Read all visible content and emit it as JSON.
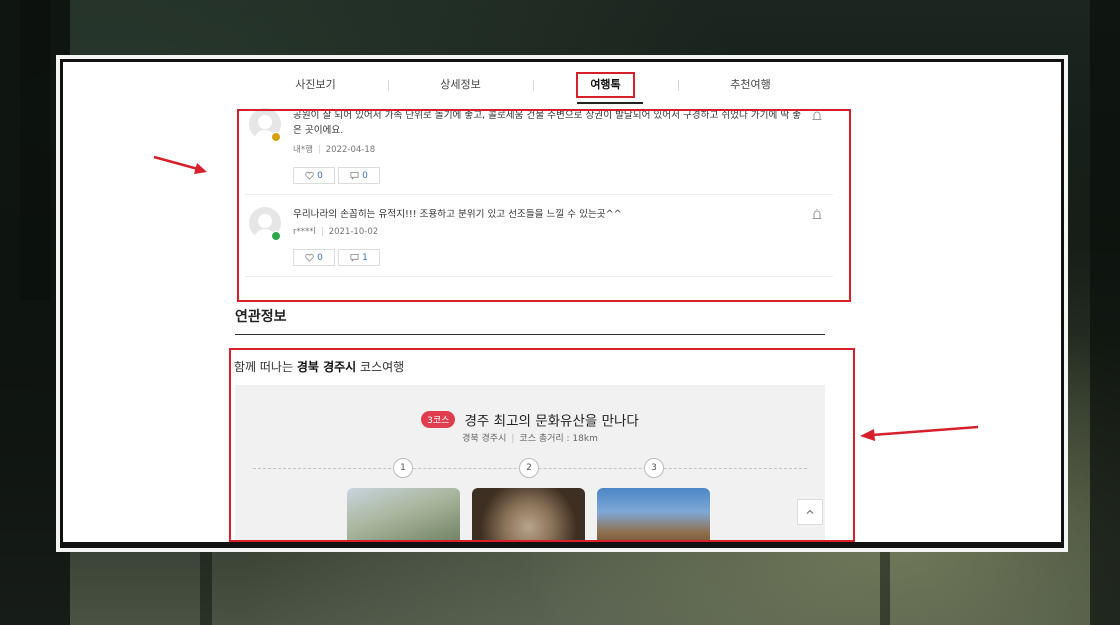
{
  "tabs": [
    {
      "label": "사진보기"
    },
    {
      "label": "상세정보"
    },
    {
      "label": "여행톡"
    },
    {
      "label": "추천여행"
    }
  ],
  "reviews": [
    {
      "text": "공원이 잘 되어 있어서 가족 단위로 놀기에 좋고, 콜로세움 건물 주변으로 상권이 발달되어 있어서 구경하고 쉬었다 가기에 딱 좋은 곳이에요.",
      "author": "내*행",
      "date": "2022-04-18",
      "likes": "0",
      "comments": "0",
      "badge_color": "#d8a10a"
    },
    {
      "text": "우리나라의 손꼽히는 유적지!!! 조용하고 분위기 있고 선조들을 느낄 수 있는곳^^",
      "author": "r****l",
      "date": "2021-10-02",
      "likes": "0",
      "comments": "1",
      "badge_color": "#2ea44f"
    }
  ],
  "related": {
    "title": "연관정보",
    "heading_prefix": "함께 떠나는 ",
    "heading_bold": "경북 경주시",
    "heading_suffix": " 코스여행"
  },
  "course": {
    "pill": "3코스",
    "title": "경주 최고의 문화유산을 만나다",
    "region": "경북 경주시",
    "distance": "코스 총거리 : 18km",
    "steps": [
      "1",
      "2",
      "3"
    ]
  },
  "colors": {
    "highlight": "#d7202b",
    "link": "#3a72b8",
    "pill": "#e03e4e"
  },
  "icons": [
    "heart-icon",
    "comment-icon",
    "report-icon",
    "chevron-up-icon"
  ]
}
